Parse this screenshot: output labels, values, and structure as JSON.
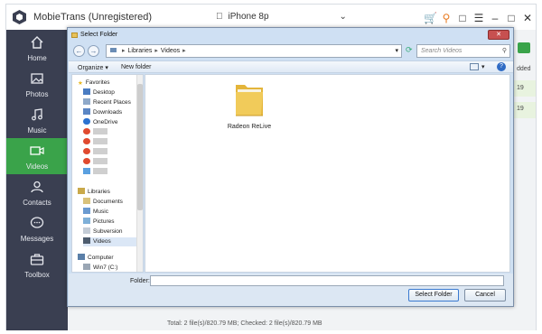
{
  "app": {
    "title": "MobieTrans (Unregistered)",
    "device": "iPhone 8p"
  },
  "sidebar": {
    "items": [
      {
        "label": "Home",
        "icon": "home-icon"
      },
      {
        "label": "Photos",
        "icon": "photos-icon"
      },
      {
        "label": "Music",
        "icon": "music-icon"
      },
      {
        "label": "Videos",
        "icon": "videos-icon",
        "active": true
      },
      {
        "label": "Contacts",
        "icon": "contacts-icon"
      },
      {
        "label": "Messages",
        "icon": "messages-icon"
      },
      {
        "label": "Toolbox",
        "icon": "toolbox-icon"
      }
    ]
  },
  "main": {
    "footer": "Total: 2 file(s)/820.79 MB; Checked: 2 file(s)/820.79 MB",
    "col_header_fragment": "dded",
    "row1_fragment": "19",
    "row2_fragment": "19"
  },
  "dialog": {
    "title": "Select Folder",
    "close": "✕",
    "address": {
      "root": "Libraries",
      "folder": "Videos"
    },
    "search_placeholder": "Search Videos",
    "toolbar": {
      "organize": "Organize ▾",
      "new_folder": "New folder",
      "help": "?"
    },
    "tree": {
      "favorites_header": "Favorites",
      "favorites": [
        "Desktop",
        "Recent Places",
        "Downloads",
        "OneDrive"
      ],
      "libraries_header": "Libraries",
      "libraries": [
        "Documents",
        "Music",
        "Pictures",
        "Subversion",
        "Videos"
      ],
      "computer_header": "Computer",
      "computer": [
        "Win7 (C:)"
      ]
    },
    "folder_item": "Radeon ReLive",
    "folder_label": "Folder:",
    "folder_value": "",
    "select_button": "Select Folder",
    "cancel_button": "Cancel"
  },
  "colors": {
    "accent": "#3aa34a",
    "sidebar_bg": "#3a3f51",
    "dialog_frame": "#cfe0f3"
  }
}
